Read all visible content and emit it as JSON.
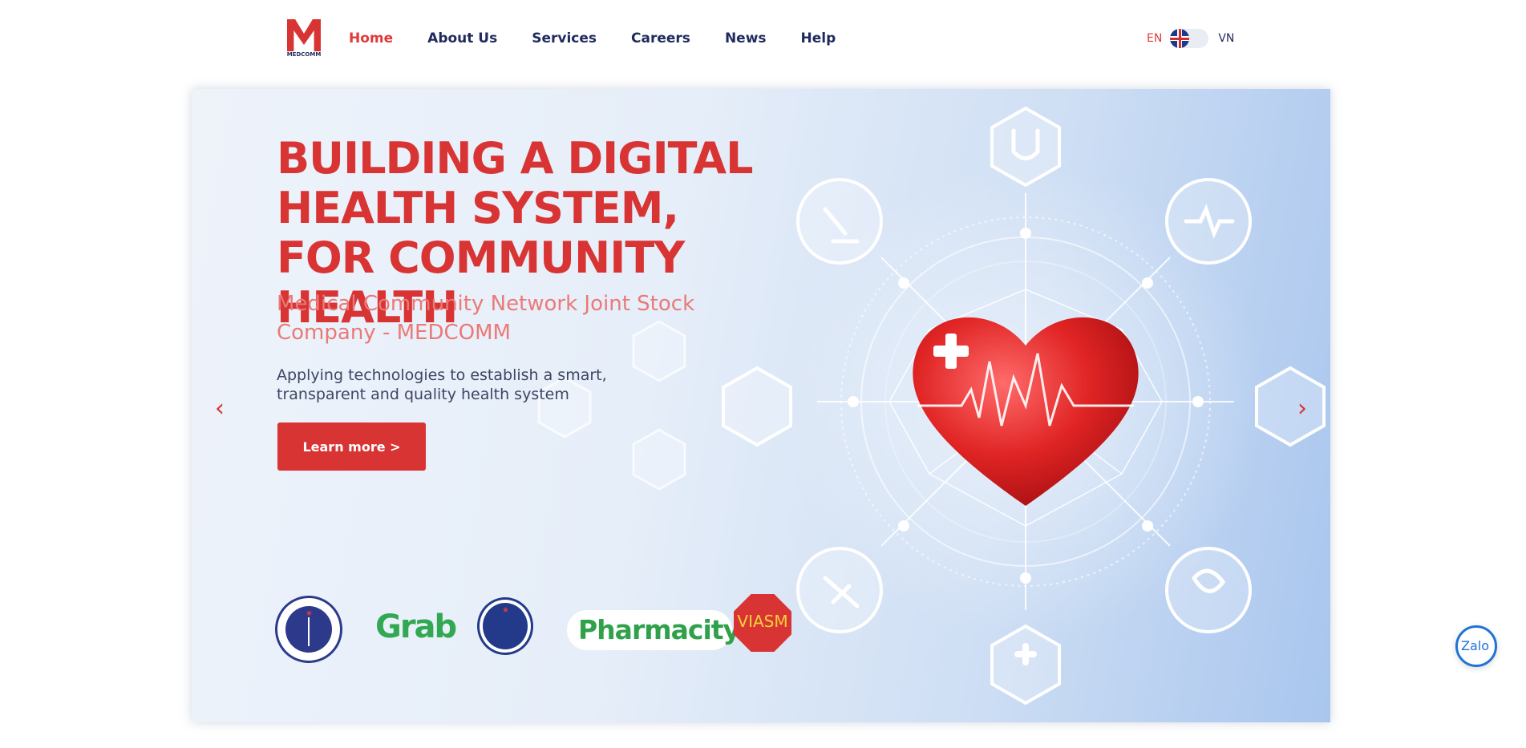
{
  "brand": {
    "logo_text": "MEDCOMM"
  },
  "nav": {
    "items": [
      {
        "label": "Home",
        "active": true
      },
      {
        "label": "About Us"
      },
      {
        "label": "Services"
      },
      {
        "label": "Careers"
      },
      {
        "label": "News"
      },
      {
        "label": "Help"
      }
    ]
  },
  "language": {
    "en": "EN",
    "vn": "VN",
    "flag_icon": "uk-flag-icon"
  },
  "hero": {
    "headline": "BUILDING A DIGITAL HEALTH SYSTEM, FOR COMMUNITY HEALTH",
    "subtitle": "Medical Community Network Joint Stock Company - MEDCOMM",
    "description": "Applying technologies to establish a smart, transparent and quality health system",
    "cta_label": "Learn more >",
    "prev_icon": "chevron-left-icon",
    "next_icon": "chevron-right-icon"
  },
  "partners": {
    "grab": "Grab",
    "pharmacity": "Pharmacity",
    "viasm": "VIASM"
  },
  "zalo": {
    "label": "Zalo"
  },
  "colors": {
    "primary": "#d93434",
    "navy": "#1f2b5e",
    "accent_light": "#ea7a78"
  }
}
